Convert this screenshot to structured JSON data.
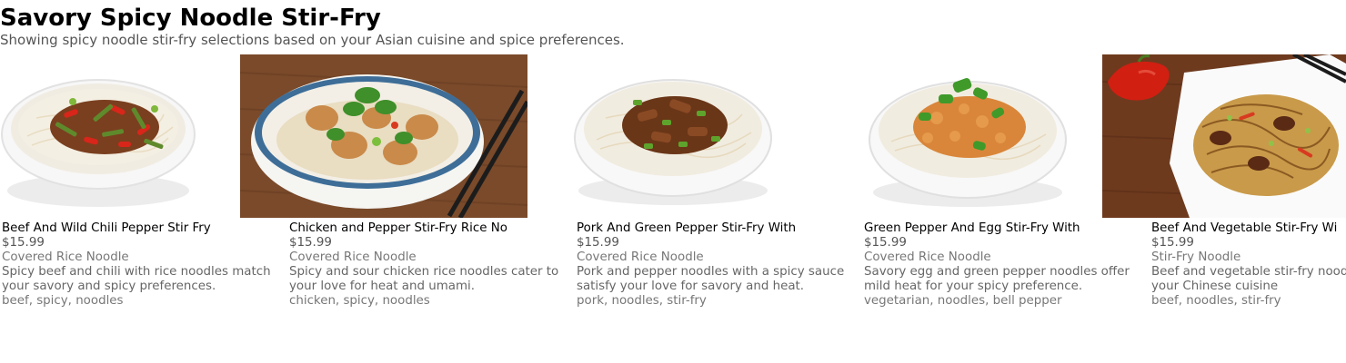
{
  "page": {
    "title": "Savory Spicy Noodle Stir-Fry",
    "subtitle": "Showing spicy noodle stir-fry selections based on your Asian cuisine and spice preferences."
  },
  "dishes": [
    {
      "name": "Beef And Wild Chili Pepper Stir Fry",
      "price": "$15.99",
      "category": "Covered Rice Noodle",
      "description": "Spicy beef and chili with rice noodles match your savory and spicy preferences.",
      "tags": "beef, spicy, noodles"
    },
    {
      "name": "Chicken and Pepper Stir-Fry Rice No",
      "price": "$15.99",
      "category": "Covered Rice Noodle",
      "description": "Spicy and sour chicken rice noodles cater to your love for heat and umami.",
      "tags": "chicken, spicy, noodles"
    },
    {
      "name": "Pork And Green Pepper Stir-Fry With",
      "price": "$15.99",
      "category": "Covered Rice Noodle",
      "description": "Pork and pepper noodles with a spicy sauce satisfy your love for savory and heat.",
      "tags": "pork, noodles, stir-fry"
    },
    {
      "name": "Green Pepper And Egg Stir-Fry With",
      "price": "$15.99",
      "category": "Covered Rice Noodle",
      "description": "Savory egg and green pepper noodles offer mild heat for your spicy preference.",
      "tags": "vegetarian, noodles, bell pepper"
    },
    {
      "name": "Beef And Vegetable Stir-Fry Wi",
      "price": "$15.99",
      "category": "Stir-Fry Noodle",
      "description": "Beef and vegetable stir-fry noodles align with your Chinese cuisine",
      "tags": "beef, noodles, stir-fry"
    }
  ]
}
